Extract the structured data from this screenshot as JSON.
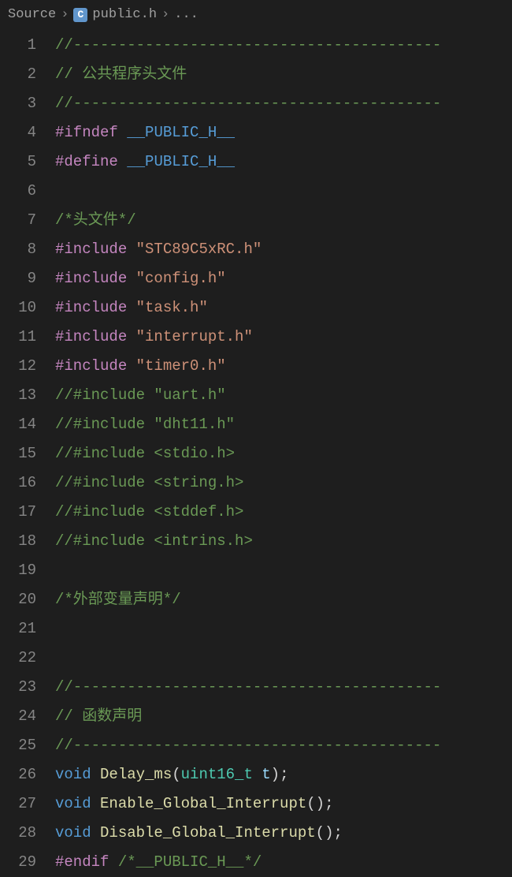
{
  "breadcrumbs": {
    "folder": "Source",
    "icon_letter": "C",
    "filename": "public.h",
    "tail": "..."
  },
  "lines": [
    {
      "n": 1,
      "tokens": [
        {
          "cls": "c-comment",
          "t": "//-----------------------------------------"
        }
      ]
    },
    {
      "n": 2,
      "tokens": [
        {
          "cls": "c-comment",
          "t": "// 公共程序头文件"
        }
      ]
    },
    {
      "n": 3,
      "tokens": [
        {
          "cls": "c-comment",
          "t": "//-----------------------------------------"
        }
      ]
    },
    {
      "n": 4,
      "tokens": [
        {
          "cls": "c-keyword",
          "t": "#ifndef"
        },
        {
          "cls": "",
          "t": " "
        },
        {
          "cls": "c-macro",
          "t": "__PUBLIC_H__"
        }
      ]
    },
    {
      "n": 5,
      "tokens": [
        {
          "cls": "c-keyword",
          "t": "#define"
        },
        {
          "cls": "",
          "t": " "
        },
        {
          "cls": "c-macro",
          "t": "__PUBLIC_H__"
        }
      ]
    },
    {
      "n": 6,
      "tokens": []
    },
    {
      "n": 7,
      "tokens": [
        {
          "cls": "c-comment",
          "t": "/*头文件*/"
        }
      ]
    },
    {
      "n": 8,
      "tokens": [
        {
          "cls": "c-keyword",
          "t": "#include"
        },
        {
          "cls": "",
          "t": " "
        },
        {
          "cls": "c-string",
          "t": "\"STC89C5xRC.h\""
        }
      ]
    },
    {
      "n": 9,
      "tokens": [
        {
          "cls": "c-keyword",
          "t": "#include"
        },
        {
          "cls": "",
          "t": " "
        },
        {
          "cls": "c-string",
          "t": "\"config.h\""
        }
      ]
    },
    {
      "n": 10,
      "tokens": [
        {
          "cls": "c-keyword",
          "t": "#include"
        },
        {
          "cls": "",
          "t": " "
        },
        {
          "cls": "c-string",
          "t": "\"task.h\""
        }
      ]
    },
    {
      "n": 11,
      "tokens": [
        {
          "cls": "c-keyword",
          "t": "#include"
        },
        {
          "cls": "",
          "t": " "
        },
        {
          "cls": "c-string",
          "t": "\"interrupt.h\""
        }
      ]
    },
    {
      "n": 12,
      "tokens": [
        {
          "cls": "c-keyword",
          "t": "#include"
        },
        {
          "cls": "",
          "t": " "
        },
        {
          "cls": "c-string",
          "t": "\"timer0.h\""
        }
      ]
    },
    {
      "n": 13,
      "tokens": [
        {
          "cls": "c-comment",
          "t": "//#include \"uart.h\""
        }
      ]
    },
    {
      "n": 14,
      "tokens": [
        {
          "cls": "c-comment",
          "t": "//#include \"dht11.h\""
        }
      ]
    },
    {
      "n": 15,
      "tokens": [
        {
          "cls": "c-comment",
          "t": "//#include <stdio.h>"
        }
      ]
    },
    {
      "n": 16,
      "tokens": [
        {
          "cls": "c-comment",
          "t": "//#include <string.h>"
        }
      ]
    },
    {
      "n": 17,
      "tokens": [
        {
          "cls": "c-comment",
          "t": "//#include <stddef.h>"
        }
      ]
    },
    {
      "n": 18,
      "tokens": [
        {
          "cls": "c-comment",
          "t": "//#include <intrins.h>"
        }
      ]
    },
    {
      "n": 19,
      "tokens": []
    },
    {
      "n": 20,
      "tokens": [
        {
          "cls": "c-comment",
          "t": "/*外部变量声明*/"
        }
      ]
    },
    {
      "n": 21,
      "tokens": []
    },
    {
      "n": 22,
      "tokens": []
    },
    {
      "n": 23,
      "tokens": [
        {
          "cls": "c-comment",
          "t": "//-----------------------------------------"
        }
      ]
    },
    {
      "n": 24,
      "tokens": [
        {
          "cls": "c-comment",
          "t": "// 函数声明"
        }
      ]
    },
    {
      "n": 25,
      "tokens": [
        {
          "cls": "c-comment",
          "t": "//-----------------------------------------"
        }
      ]
    },
    {
      "n": 26,
      "tokens": [
        {
          "cls": "c-type",
          "t": "void"
        },
        {
          "cls": "",
          "t": " "
        },
        {
          "cls": "c-func",
          "t": "Delay_ms"
        },
        {
          "cls": "c-paren",
          "t": "("
        },
        {
          "cls": "c-ptype",
          "t": "uint16_t"
        },
        {
          "cls": "",
          "t": " "
        },
        {
          "cls": "c-param",
          "t": "t"
        },
        {
          "cls": "c-paren",
          "t": ");"
        }
      ]
    },
    {
      "n": 27,
      "tokens": [
        {
          "cls": "c-type",
          "t": "void"
        },
        {
          "cls": "",
          "t": " "
        },
        {
          "cls": "c-func",
          "t": "Enable_Global_Interrupt"
        },
        {
          "cls": "c-paren",
          "t": "();"
        }
      ]
    },
    {
      "n": 28,
      "tokens": [
        {
          "cls": "c-type",
          "t": "void"
        },
        {
          "cls": "",
          "t": " "
        },
        {
          "cls": "c-func",
          "t": "Disable_Global_Interrupt"
        },
        {
          "cls": "c-paren",
          "t": "();"
        }
      ]
    },
    {
      "n": 29,
      "tokens": [
        {
          "cls": "c-keyword",
          "t": "#endif"
        },
        {
          "cls": "",
          "t": " "
        },
        {
          "cls": "c-comment",
          "t": "/*__PUBLIC_H__*/"
        }
      ]
    }
  ]
}
